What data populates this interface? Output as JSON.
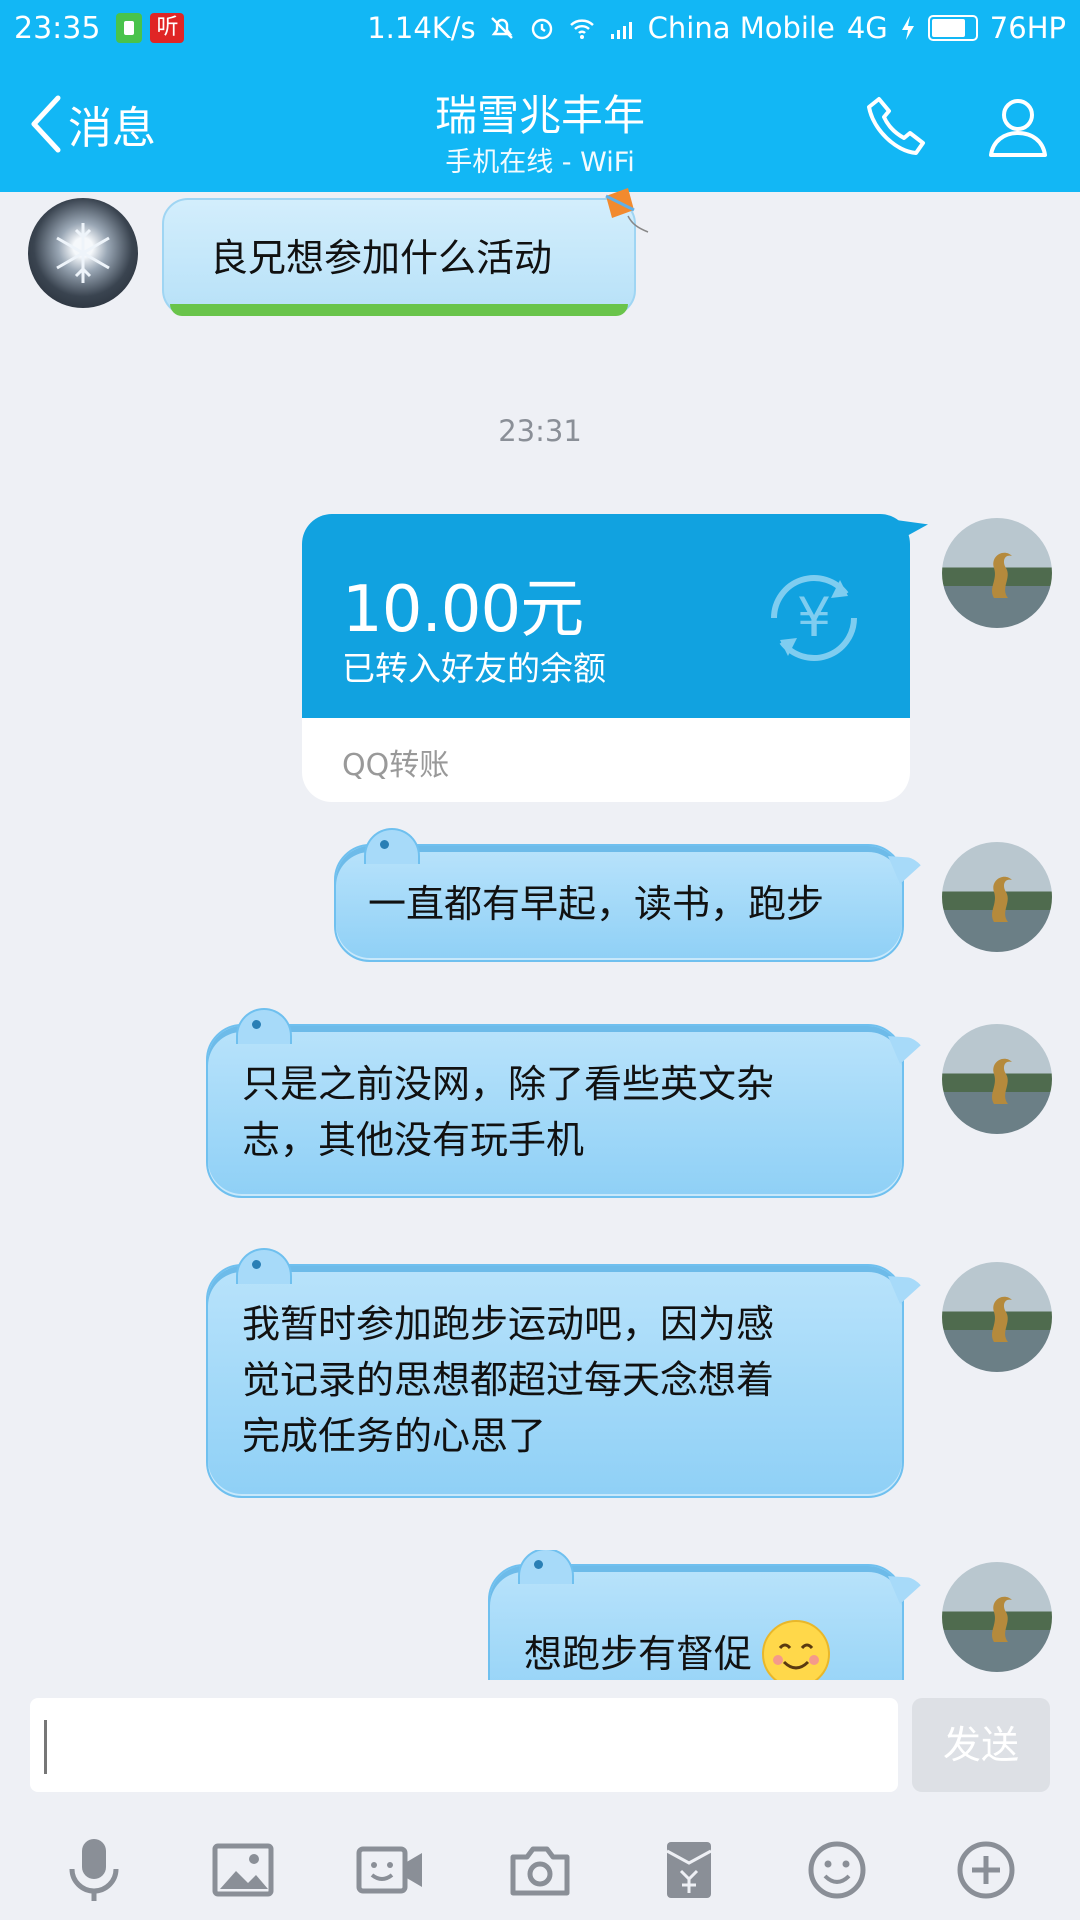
{
  "status_bar": {
    "time": "23:35",
    "listen_badge": "听",
    "net_speed": "1.14K/s",
    "carrier": "China Mobile",
    "network": "4G",
    "battery": "76HP",
    "battery_level": 0.76
  },
  "header": {
    "back_label": "消息",
    "title": "瑞雪兆丰年",
    "subtitle": "手机在线 - WiFi"
  },
  "chat": {
    "received_text": "良兄想参加什么活动",
    "timestamp": "23:31",
    "transfer": {
      "amount": "10.00元",
      "description": "已转入好友的余额",
      "label": "QQ转账",
      "currency_icon": "¥"
    },
    "messages": [
      "一直都有早起，读书，跑步",
      "只是之前没网，除了看些英文杂\n志，其他没有玩手机",
      "我暂时参加跑步运动吧，因为感\n觉记录的思想都超过每天念想着\n完成任务的心思了",
      "想跑步有督促"
    ]
  },
  "input": {
    "value": "",
    "send_label": "发送"
  },
  "toolbar": {
    "icons": [
      "microphone-icon",
      "image-icon",
      "video-icon",
      "camera-icon",
      "red-packet-icon",
      "emoji-icon",
      "plus-icon"
    ]
  },
  "colors": {
    "header": "#12b7f5",
    "bubble": "#a7daf9",
    "transfer": "#11a2e0"
  }
}
